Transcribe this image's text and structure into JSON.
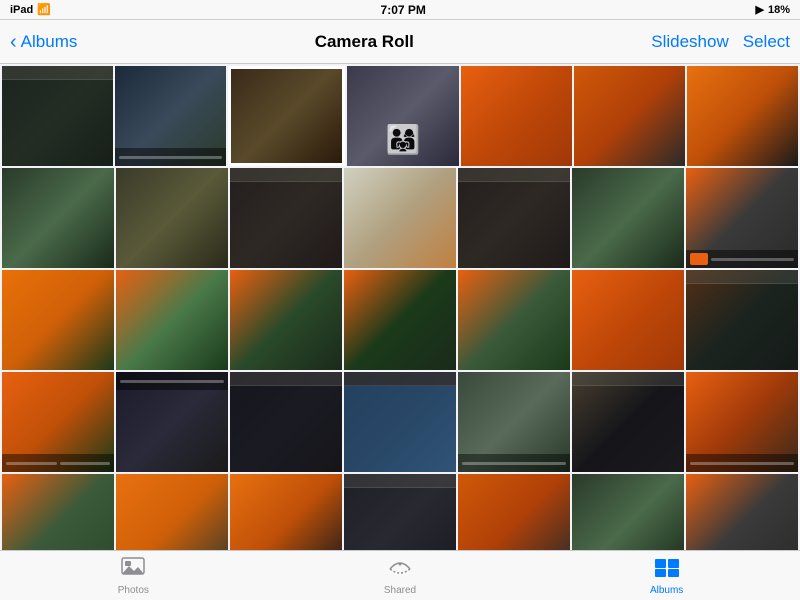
{
  "statusBar": {
    "carrier": "iPad",
    "wifi": "wifi",
    "time": "7:07 PM",
    "battery": "18%",
    "batteryIcon": "🔋"
  },
  "navBar": {
    "backLabel": "Albums",
    "title": "Camera Roll",
    "slideshowLabel": "Slideshow",
    "selectLabel": "Select"
  },
  "tabBar": {
    "tabs": [
      {
        "id": "photos",
        "label": "Photos",
        "icon": "▦",
        "active": false
      },
      {
        "id": "shared",
        "label": "Shared",
        "icon": "☁",
        "active": false
      },
      {
        "id": "albums",
        "label": "Albums",
        "icon": "▪",
        "active": true
      }
    ]
  },
  "grid": {
    "rows": 5,
    "cols": 7
  }
}
